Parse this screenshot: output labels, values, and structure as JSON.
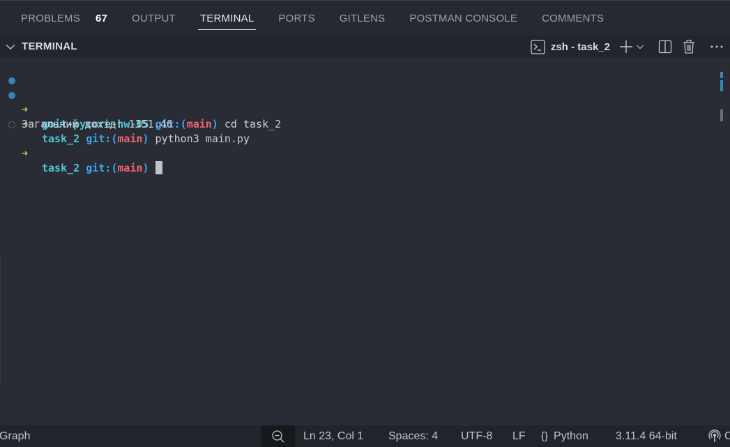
{
  "panel_tabs": [
    {
      "label": "PROBLEMS",
      "badge": "67",
      "active": false
    },
    {
      "label": "OUTPUT",
      "active": false
    },
    {
      "label": "TERMINAL",
      "active": true
    },
    {
      "label": "PORTS",
      "active": false
    },
    {
      "label": "GITLENS",
      "active": false
    },
    {
      "label": "POSTMAN CONSOLE",
      "active": false
    },
    {
      "label": "COMMENTS",
      "active": false
    }
  ],
  "terminal_header": {
    "title": "TERMINAL",
    "shell_name": "zsh - task_2",
    "icons": [
      "chevron-down-icon",
      "terminal-shell-icon",
      "plus-icon",
      "dropdown-chevron-icon",
      "split-icon",
      "trash-icon",
      "more-icon"
    ]
  },
  "terminal": {
    "prompt_arrow": "➜",
    "lines": [
      {
        "status": "filled",
        "dir": "goit-pycore-hw-05",
        "git_prefix": "git:(",
        "branch": "main",
        "git_suffix": ")",
        "command": " cd task_2"
      },
      {
        "status": "filled",
        "dir": "task_2",
        "git_prefix": "git:(",
        "branch": "main",
        "git_suffix": ")",
        "command": " python3 main.py"
      },
      {
        "output": "Загальний дохід: 1351.46"
      },
      {
        "status": "hollow",
        "dir": "task_2",
        "git_prefix": "git:(",
        "branch": "main",
        "git_suffix": ")",
        "command": " "
      }
    ]
  },
  "status_bar": {
    "left_item": "Graph",
    "position": "Ln 23, Col 1",
    "indentation": "Spaces: 4",
    "encoding": "UTF-8",
    "eol": "LF",
    "language_icon": "{}",
    "language": "Python",
    "interpreter": "3.11.4 64-bit",
    "icons": [
      "zoom-out-icon",
      "language-braces-icon",
      "broadcast-icon"
    ]
  },
  "colors": {
    "panel_bg": "#292c35",
    "tabs_bg": "#262932",
    "header_bg": "#22252c",
    "statusbar_bg": "#21242b",
    "dir_cyan": "#4fc6d6",
    "git_blue": "#3fa4e8",
    "branch_red": "#f0646e",
    "arrow_green": "#b7d86e",
    "decoration_blue": "#3a84b5"
  }
}
